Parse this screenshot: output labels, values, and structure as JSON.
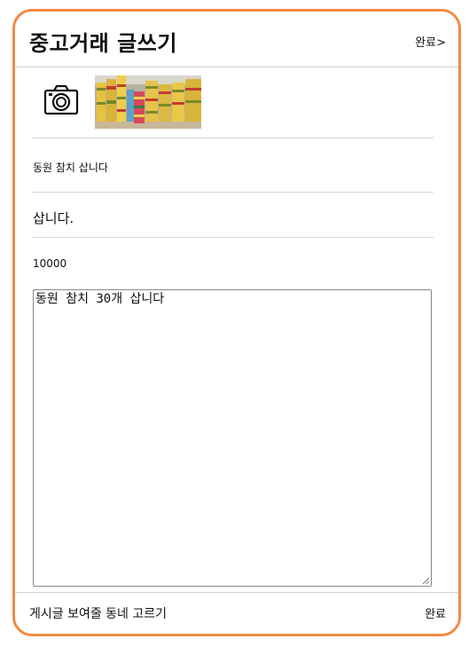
{
  "header": {
    "title": "중고거래 글쓰기",
    "done_label": "완료>"
  },
  "photo": {
    "camera_icon": "camera-icon",
    "thumbnail_subject": "tuna-cans-photo"
  },
  "form": {
    "title_value": "동원 참치 삽니다",
    "category_value": "삽니다.",
    "price_value": "10000",
    "description_value": "동원 참치 30개 삽니다"
  },
  "footer": {
    "neighborhood_label": "게시글 보여줄 동네 고르기",
    "done_label": "완료"
  },
  "colors": {
    "accent": "#f08b45",
    "divider": "#d4d4d4"
  }
}
